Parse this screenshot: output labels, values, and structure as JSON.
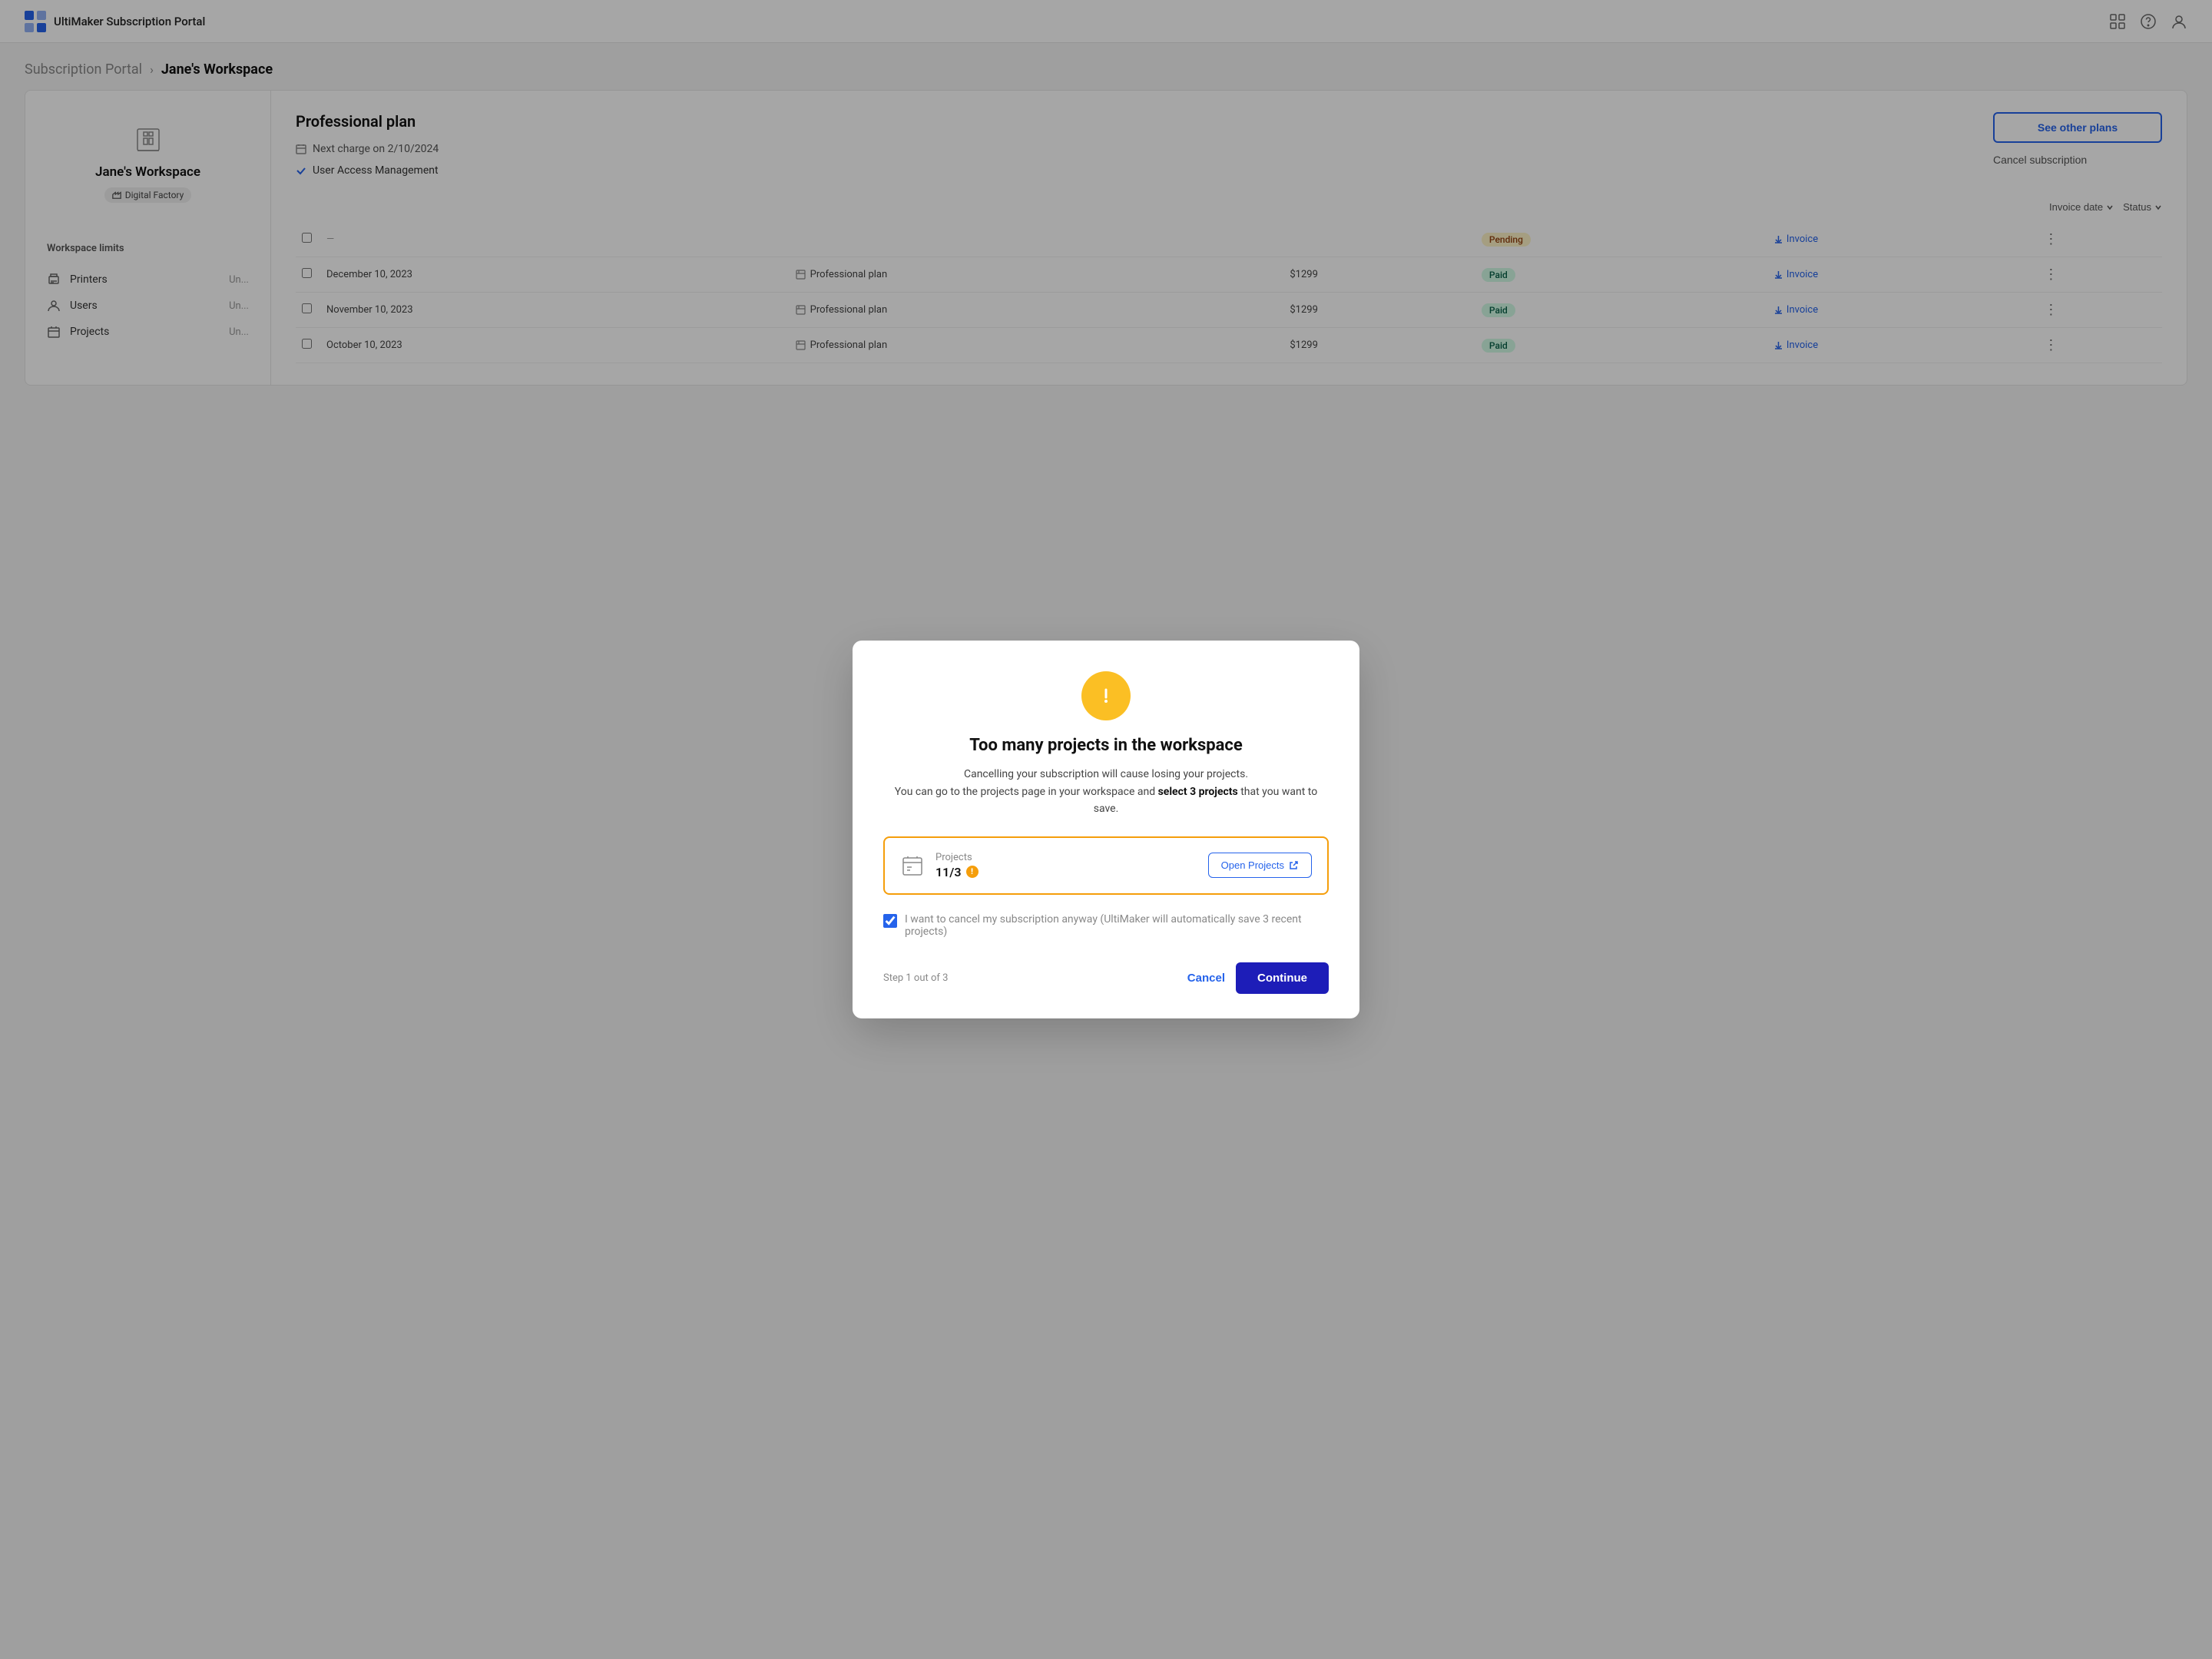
{
  "nav": {
    "logo_alt": "UltiMaker Logo",
    "title": "UltiMaker Subscription Portal"
  },
  "breadcrumb": {
    "link": "Subscription Portal",
    "sep": "›",
    "current": "Jane's Workspace"
  },
  "sidebar": {
    "workspace_name": "Jane's Workspace",
    "badge_label": "Digital Factory",
    "limits_title": "Workspace limits",
    "items": [
      {
        "label": "Printers",
        "value": "Un..."
      },
      {
        "label": "Users",
        "value": "Un..."
      },
      {
        "label": "Projects",
        "value": "Un..."
      }
    ]
  },
  "plan": {
    "title": "Professional plan",
    "next_charge": "Next charge on 2/10/2024",
    "feature": "User Access Management",
    "btn_see_plans": "See other plans",
    "btn_cancel": "Cancel subscription"
  },
  "table": {
    "filters": [
      "Invoice date",
      "Status"
    ],
    "rows": [
      {
        "date": "December 10, 2023",
        "plan": "Professional plan",
        "amount": "$1299",
        "status": "Paid",
        "status_type": "paid"
      },
      {
        "date": "November 10, 2023",
        "plan": "Professional plan",
        "amount": "$1299",
        "status": "Paid",
        "status_type": "paid"
      },
      {
        "date": "October 10, 2023",
        "plan": "Professional plan",
        "amount": "$1299",
        "status": "Paid",
        "status_type": "paid"
      }
    ],
    "invoice_label": "Invoice",
    "pending_label": "Pending"
  },
  "modal": {
    "title": "Too many projects in the workspace",
    "desc_line1": "Cancelling your subscription will cause losing your projects.",
    "desc_line2_pre": "You can go to the projects page in your workspace and ",
    "desc_line2_bold": "select 3 projects",
    "desc_line2_post": " that you want to save.",
    "project_label": "Projects",
    "project_count": "11/3",
    "btn_open_projects": "Open Projects",
    "checkbox_label": "I want to cancel my subscription anyway",
    "checkbox_sub": " (UltiMaker will automatically save 3 recent projects)",
    "step_label": "Step 1 out of 3",
    "btn_cancel": "Cancel",
    "btn_continue": "Continue"
  }
}
